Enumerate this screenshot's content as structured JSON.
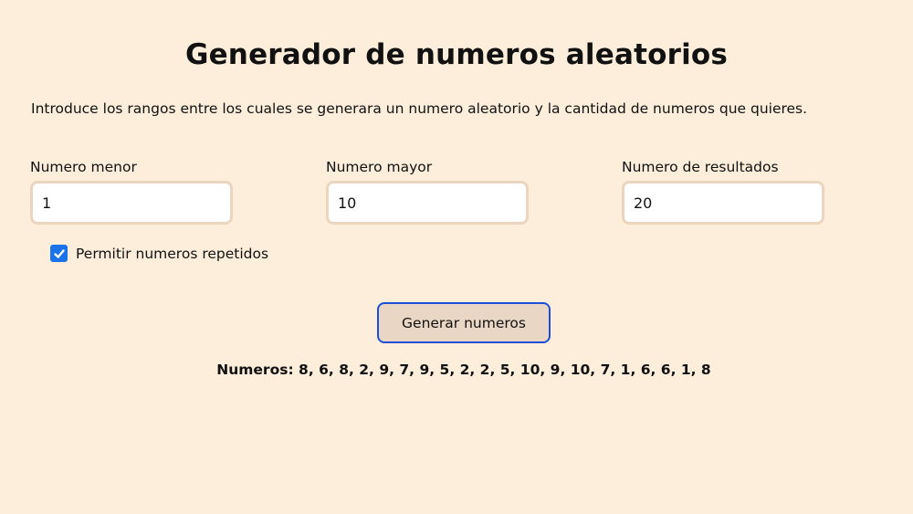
{
  "page": {
    "title": "Generador de numeros aleatorios",
    "intro": "Introduce los rangos entre los cuales se generara un numero aleatorio y la cantidad de numeros que quieres."
  },
  "fields": {
    "min": {
      "label": "Numero menor",
      "value": "1"
    },
    "max": {
      "label": "Numero mayor",
      "value": "10"
    },
    "count": {
      "label": "Numero de resultados",
      "value": "20"
    }
  },
  "options": {
    "allow_repeats_label": "Permitir numeros repetidos",
    "allow_repeats_checked": true
  },
  "actions": {
    "generate_label": "Generar numeros"
  },
  "result": {
    "text": "Numeros: 8, 6, 8, 2, 9, 7, 9, 5, 2, 2, 5, 10, 9, 10, 7, 1, 6, 6, 1, 8"
  },
  "colors": {
    "background": "#fdeedb",
    "checkbox": "#1a73e8",
    "button_border": "#1d4fd6",
    "button_bg": "#ead6c4"
  }
}
